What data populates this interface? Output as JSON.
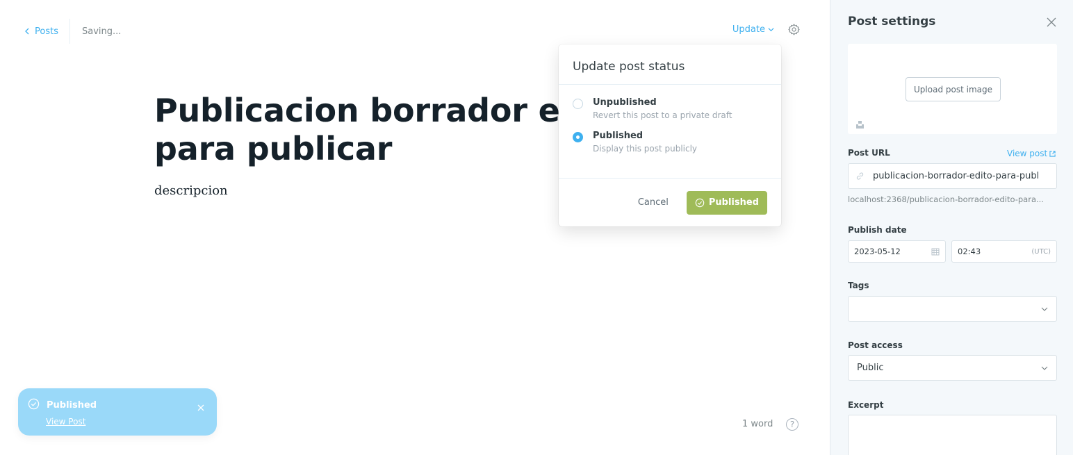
{
  "header": {
    "back_label": "Posts",
    "save_status": "Saving...",
    "update_label": "Update"
  },
  "editor": {
    "title": "Publicacion borrador edito para publicar",
    "body": "descripcion",
    "word_count": "1 word",
    "help_label": "?"
  },
  "status_popover": {
    "title": "Update post status",
    "options": [
      {
        "label": "Unpublished",
        "description": "Revert this post to a private draft",
        "selected": false
      },
      {
        "label": "Published",
        "description": "Display this post publicly",
        "selected": true
      }
    ],
    "cancel_label": "Cancel",
    "confirm_label": "Published"
  },
  "toast": {
    "title": "Published",
    "link_label": "View Post"
  },
  "settings": {
    "title": "Post settings",
    "upload_image_label": "Upload post image",
    "post_url_label": "Post URL",
    "view_post_label": "View post",
    "post_url_value": "publicacion-borrador-edito-para-publ",
    "post_url_preview": "localhost:2368/publicacion-borrador-edito-para...",
    "publish_date_label": "Publish date",
    "publish_date": "2023-05-12",
    "publish_time": "02:43",
    "timezone": "(UTC)",
    "tags_label": "Tags",
    "tags_value": "",
    "post_access_label": "Post access",
    "post_access_value": "Public",
    "excerpt_label": "Excerpt"
  },
  "colors": {
    "accent": "#3eb0ef",
    "publish_green": "#9fbb58",
    "toast_bg": "#9ad9f9"
  }
}
